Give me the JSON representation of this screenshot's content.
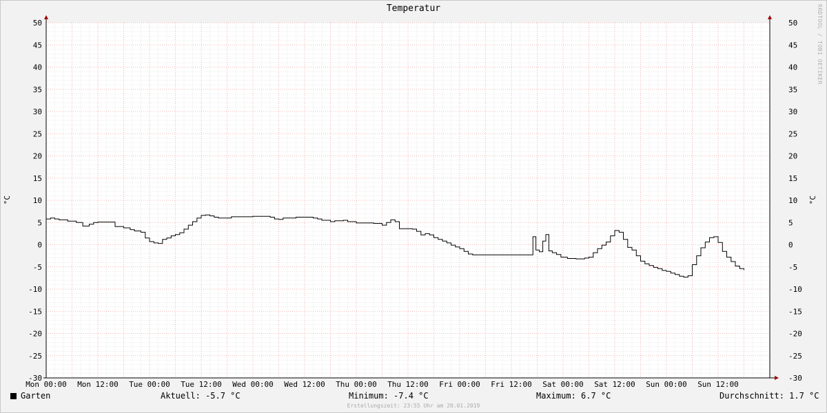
{
  "chart_data": {
    "type": "line",
    "title": "Temperatur",
    "ylabel": "°C",
    "ylim": [
      -30,
      50
    ],
    "y_ticks": [
      50,
      45,
      40,
      35,
      30,
      25,
      20,
      15,
      10,
      5,
      0,
      -5,
      -10,
      -15,
      -20,
      -25,
      -30
    ],
    "x_range_hours": [
      0,
      168
    ],
    "x_ticks": [
      {
        "h": 0,
        "label": "Mon 00:00"
      },
      {
        "h": 12,
        "label": "Mon 12:00"
      },
      {
        "h": 24,
        "label": "Tue 00:00"
      },
      {
        "h": 36,
        "label": "Tue 12:00"
      },
      {
        "h": 48,
        "label": "Wed 00:00"
      },
      {
        "h": 60,
        "label": "Wed 12:00"
      },
      {
        "h": 72,
        "label": "Thu 00:00"
      },
      {
        "h": 84,
        "label": "Thu 12:00"
      },
      {
        "h": 96,
        "label": "Fri 00:00"
      },
      {
        "h": 108,
        "label": "Fri 12:00"
      },
      {
        "h": 120,
        "label": "Sat 00:00"
      },
      {
        "h": 132,
        "label": "Sat 12:00"
      },
      {
        "h": 144,
        "label": "Sun 00:00"
      },
      {
        "h": 156,
        "label": "Sun 12:00"
      }
    ],
    "grid": true,
    "series": [
      {
        "name": "Garten",
        "color": "#000000",
        "points": [
          [
            0,
            5.8
          ],
          [
            1,
            6.0
          ],
          [
            2,
            5.8
          ],
          [
            3,
            5.6
          ],
          [
            5,
            5.3
          ],
          [
            7,
            5.0
          ],
          [
            8.5,
            4.2
          ],
          [
            10,
            4.6
          ],
          [
            11,
            5.0
          ],
          [
            12,
            5.1
          ],
          [
            16,
            4.1
          ],
          [
            18,
            3.8
          ],
          [
            19.5,
            3.4
          ],
          [
            20.5,
            3.1
          ],
          [
            22,
            2.8
          ],
          [
            23,
            1.5
          ],
          [
            24,
            0.7
          ],
          [
            25,
            0.4
          ],
          [
            26,
            0.3
          ],
          [
            27,
            1.2
          ],
          [
            28,
            1.5
          ],
          [
            29,
            2.0
          ],
          [
            30,
            2.3
          ],
          [
            31,
            2.7
          ],
          [
            32,
            3.5
          ],
          [
            33,
            4.4
          ],
          [
            34,
            5.2
          ],
          [
            35,
            6.0
          ],
          [
            36,
            6.6
          ],
          [
            37,
            6.7
          ],
          [
            38,
            6.5
          ],
          [
            39,
            6.2
          ],
          [
            40,
            6.0
          ],
          [
            43,
            6.3
          ],
          [
            46,
            6.3
          ],
          [
            48,
            6.4
          ],
          [
            52,
            6.2
          ],
          [
            53,
            5.8
          ],
          [
            54,
            5.7
          ],
          [
            55,
            6.0
          ],
          [
            58,
            6.2
          ],
          [
            62,
            6.0
          ],
          [
            63,
            5.8
          ],
          [
            64,
            5.5
          ],
          [
            66,
            5.2
          ],
          [
            67,
            5.4
          ],
          [
            69,
            5.5
          ],
          [
            70,
            5.2
          ],
          [
            72,
            4.9
          ],
          [
            76,
            4.8
          ],
          [
            78,
            4.4
          ],
          [
            79,
            5.0
          ],
          [
            80,
            5.6
          ],
          [
            81,
            5.2
          ],
          [
            82,
            3.6
          ],
          [
            85,
            3.5
          ],
          [
            86,
            3.0
          ],
          [
            87,
            2.2
          ],
          [
            88,
            2.5
          ],
          [
            89,
            2.2
          ],
          [
            90,
            1.6
          ],
          [
            91,
            1.2
          ],
          [
            92,
            0.8
          ],
          [
            93,
            0.4
          ],
          [
            94,
            -0.1
          ],
          [
            95,
            -0.5
          ],
          [
            96,
            -0.9
          ],
          [
            97,
            -1.5
          ],
          [
            98,
            -2.1
          ],
          [
            99,
            -2.3
          ],
          [
            113,
            -2.3
          ],
          [
            113,
            1.8
          ],
          [
            113.7,
            -1.2
          ],
          [
            114.5,
            -1.6
          ],
          [
            115.3,
            0.8
          ],
          [
            116,
            2.3
          ],
          [
            116.7,
            -1.4
          ],
          [
            117.5,
            -1.8
          ],
          [
            118.5,
            -2.2
          ],
          [
            119.5,
            -2.8
          ],
          [
            121,
            -3.1
          ],
          [
            123,
            -3.2
          ],
          [
            125,
            -3.0
          ],
          [
            126,
            -2.8
          ],
          [
            127,
            -1.8
          ],
          [
            128,
            -0.9
          ],
          [
            129,
            -0.1
          ],
          [
            130,
            0.6
          ],
          [
            131,
            2.0
          ],
          [
            132,
            3.2
          ],
          [
            133,
            2.8
          ],
          [
            134,
            1.2
          ],
          [
            135,
            -0.6
          ],
          [
            136,
            -1.2
          ],
          [
            137,
            -2.5
          ],
          [
            138,
            -3.7
          ],
          [
            139,
            -4.3
          ],
          [
            140,
            -4.7
          ],
          [
            141,
            -5.1
          ],
          [
            142,
            -5.4
          ],
          [
            143,
            -5.8
          ],
          [
            144,
            -6.0
          ],
          [
            145,
            -6.4
          ],
          [
            146,
            -6.7
          ],
          [
            147,
            -7.1
          ],
          [
            148,
            -7.3
          ],
          [
            149,
            -7.0
          ],
          [
            150,
            -4.5
          ],
          [
            151,
            -2.5
          ],
          [
            152,
            -0.7
          ],
          [
            153,
            0.6
          ],
          [
            154,
            1.6
          ],
          [
            155,
            1.8
          ],
          [
            156,
            0.5
          ],
          [
            157,
            -1.5
          ],
          [
            158,
            -2.8
          ],
          [
            159,
            -3.8
          ],
          [
            160,
            -4.8
          ],
          [
            161,
            -5.4
          ],
          [
            162,
            -5.7
          ]
        ]
      }
    ]
  },
  "legend": {
    "series_label": "Garten",
    "current": "Aktuell: -5.7 °C",
    "minimum": "Minimum: -7.4 °C",
    "maximum": "Maximum: 6.7 °C",
    "average": "Durchschnitt: 1.7 °C"
  },
  "footer": "Erstellungszeit: 23:55 Uhr am 20.01.2019",
  "side_credit": "RRDTOOL / TOBI OETIKER"
}
